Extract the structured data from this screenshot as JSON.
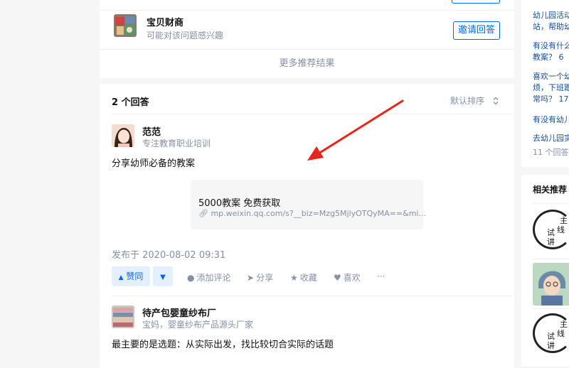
{
  "invite_row": {
    "name": "宝贝财商",
    "subtitle": "可能对该问题感兴趣",
    "button": "邀请回答"
  },
  "more_results": "更多推荐结果",
  "answers_header": {
    "count": "2 个回答",
    "sort": "默认排序"
  },
  "answer1": {
    "author": "范范",
    "bio": "专注教育职业培训",
    "content": "分享幼师必备的教案",
    "link_card": {
      "title": "5000教案 免费获取",
      "url": "mp.weixin.qq.com/s?__biz=Mzg5MjlyOTQyMA==&mi..."
    },
    "date": "发布于 2020-08-02 09:31",
    "actions": {
      "upvote": "赞同",
      "comment": "添加评论",
      "share": "分享",
      "favorite": "收藏",
      "like": "喜欢",
      "more": "···"
    }
  },
  "answer2": {
    "author": "待产包婴童纱布厂",
    "bio": "宝妈，婴童纱布产品源头厂家",
    "content": "最主要的是选题：从实际出发，找比较切合实际的话题"
  },
  "sidebar_questions": [
    {
      "line1": "幼儿园活动",
      "line2": "站，帮助幼"
    },
    {
      "line1": "有没有什么",
      "line2": "教案？ 6"
    },
    {
      "line1": "喜欢一个幼",
      "line2": "烦，下班跟",
      "line3": "常吗？ 17"
    },
    {
      "line1": "有没有幼儿"
    },
    {
      "line1": "去幼儿园实",
      "sub": "11 个回答"
    }
  ],
  "related": {
    "title": "相关推荐",
    "stamp_chars": [
      "主",
      "线",
      "试",
      "讲"
    ]
  },
  "colors": {
    "accent": "#0066ff",
    "link": "#175199",
    "muted": "#8590a6",
    "arrow": "#e8241c"
  }
}
